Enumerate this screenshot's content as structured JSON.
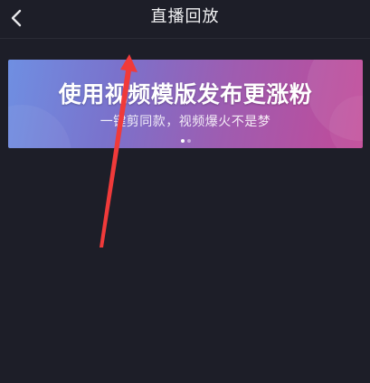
{
  "header": {
    "title": "直播回放",
    "back_icon": "chevron-left-icon"
  },
  "banner": {
    "title": "使用视频模版发布更涨粉",
    "subtitle": "一键剪同款，视频爆火不是梦",
    "pages": 2,
    "active_page": 1
  },
  "colors": {
    "background": "#1d1e28",
    "arrow": "#f03a3a",
    "banner_start": "#6f8fe2",
    "banner_end": "#c24a98"
  }
}
